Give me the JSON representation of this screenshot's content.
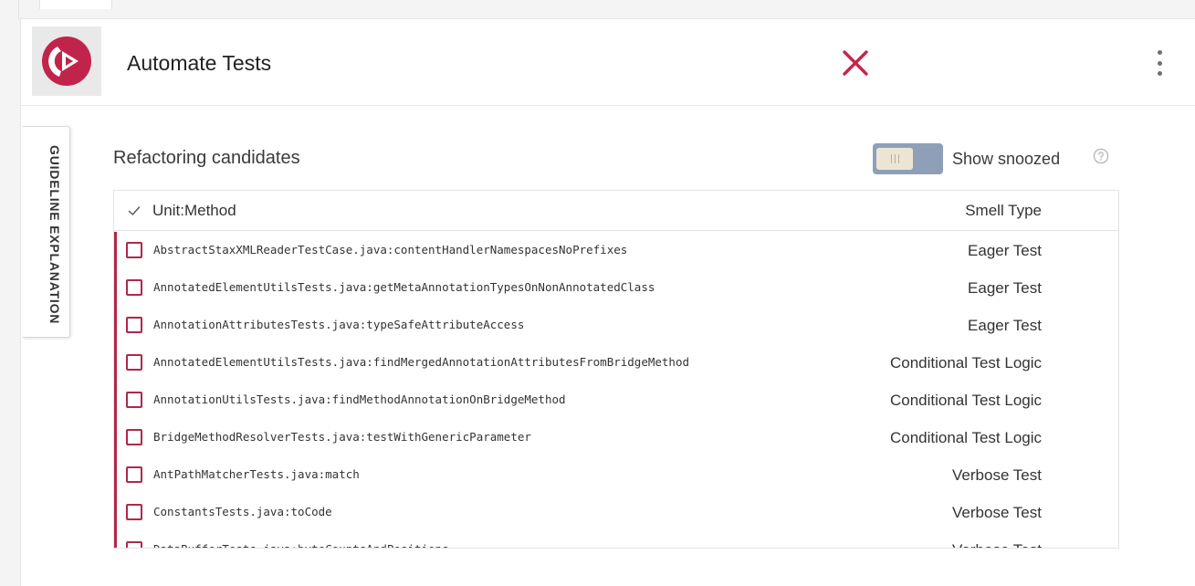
{
  "header": {
    "title": "Automate Tests",
    "status_icon": "close-x-icon",
    "status_color": "#c8234b",
    "menu_icon": "more-vertical-icon"
  },
  "logo": {
    "icon": "play-logo-icon",
    "color": "#c1244a"
  },
  "side_tab": {
    "label": "GUIDELINE EXPLANATION"
  },
  "section": {
    "title": "Refactoring candidates"
  },
  "toggle": {
    "label": "Show snoozed",
    "checked": false
  },
  "help": {
    "icon": "question-circle-icon"
  },
  "table": {
    "columns": {
      "unit": "Unit:Method",
      "smell": "Smell Type"
    },
    "rows": [
      {
        "unit": "AbstractStaxXMLReaderTestCase.java:contentHandlerNamespacesNoPrefixes",
        "smell": "Eager Test"
      },
      {
        "unit": "AnnotatedElementUtilsTests.java:getMetaAnnotationTypesOnNonAnnotatedClass",
        "smell": "Eager Test"
      },
      {
        "unit": "AnnotationAttributesTests.java:typeSafeAttributeAccess",
        "smell": "Eager Test"
      },
      {
        "unit": "AnnotatedElementUtilsTests.java:findMergedAnnotationAttributesFromBridgeMethod",
        "smell": "Conditional Test Logic"
      },
      {
        "unit": "AnnotationUtilsTests.java:findMethodAnnotationOnBridgeMethod",
        "smell": "Conditional Test Logic"
      },
      {
        "unit": "BridgeMethodResolverTests.java:testWithGenericParameter",
        "smell": "Conditional Test Logic"
      },
      {
        "unit": "AntPathMatcherTests.java:match",
        "smell": "Verbose Test"
      },
      {
        "unit": "ConstantsTests.java:toCode",
        "smell": "Verbose Test"
      },
      {
        "unit": "DataBufferTests.java:byteCountsAndPositions",
        "smell": "Verbose Test"
      }
    ]
  },
  "colors": {
    "accent": "#b2274a",
    "toggle_track": "#8f9fb8",
    "toggle_knob": "#ede5d4"
  }
}
